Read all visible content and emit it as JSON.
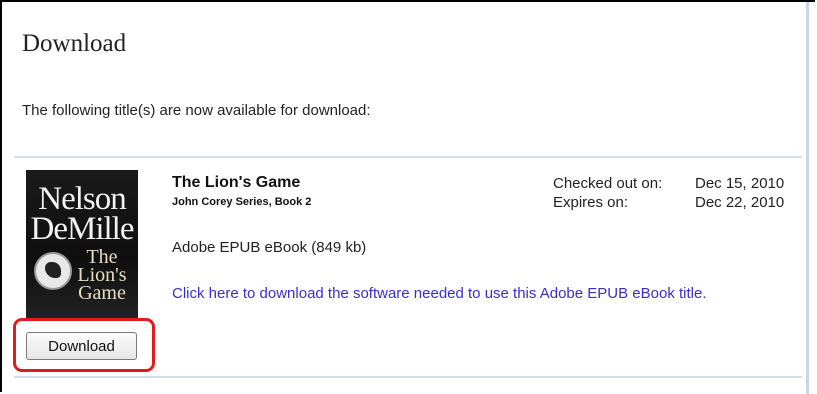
{
  "page": {
    "title": "Download",
    "intro": "The following title(s) are now available for download:"
  },
  "item": {
    "cover": {
      "author": "Nelson DeMille",
      "title": "The Lion's Game",
      "alt": "Book cover: The Lion's Game by Nelson DeMille"
    },
    "title": "The Lion's Game",
    "series": "John Corey Series, Book 2",
    "format": "Adobe EPUB eBook (849 kb)",
    "software_link": "Click here to download the software needed to use this Adobe EPUB eBook title.",
    "checked_out_label": "Checked out on:",
    "checked_out_date": "Dec 15, 2010",
    "expires_label": "Expires on:",
    "expires_date": "Dec 22, 2010",
    "download_button": "Download"
  },
  "colors": {
    "link": "#3b2dcc",
    "highlight": "#e01b1b",
    "divider": "#d5dfeb"
  }
}
